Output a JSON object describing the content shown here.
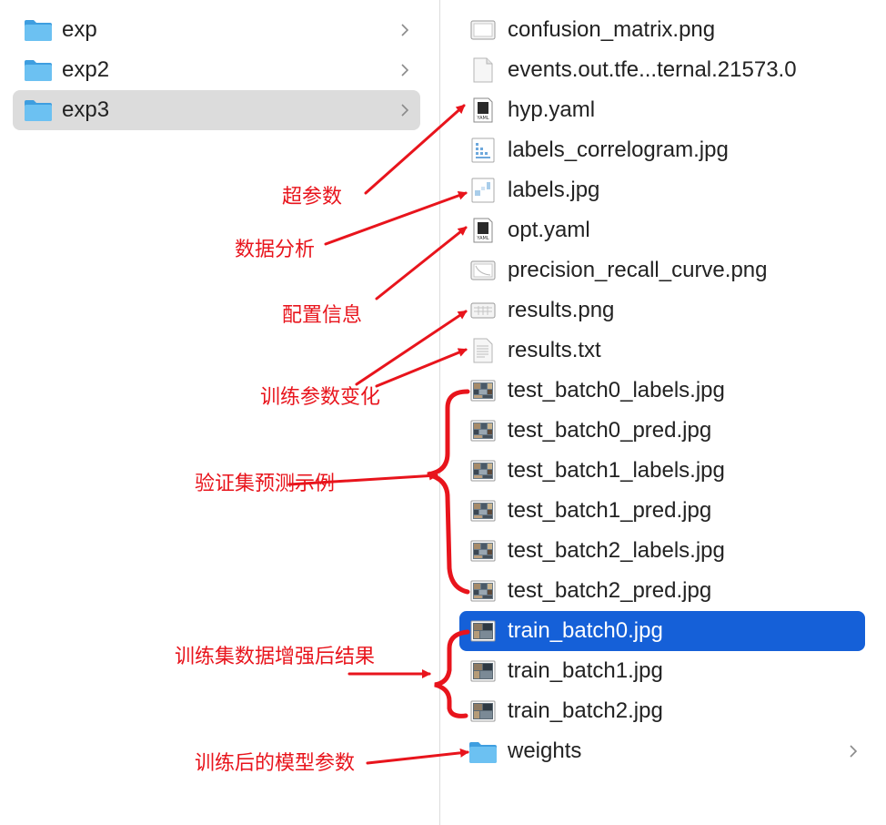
{
  "left_column": {
    "folders": [
      {
        "label": "exp",
        "icon": "folder-icon",
        "selected": false
      },
      {
        "label": "exp2",
        "icon": "folder-icon",
        "selected": false
      },
      {
        "label": "exp3",
        "icon": "folder-icon",
        "selected": true
      }
    ]
  },
  "right_column": {
    "files": [
      {
        "label": "confusion_matrix.png",
        "icon": "image-file-icon"
      },
      {
        "label": "events.out.tfe...ternal.21573.0",
        "icon": "blank-file-icon"
      },
      {
        "label": "hyp.yaml",
        "icon": "yaml-file-icon",
        "icon_text": "YAML"
      },
      {
        "label": "labels_correlogram.jpg",
        "icon": "image-file-icon"
      },
      {
        "label": "labels.jpg",
        "icon": "image-file-icon"
      },
      {
        "label": "opt.yaml",
        "icon": "yaml-file-icon",
        "icon_text": "YAML"
      },
      {
        "label": "precision_recall_curve.png",
        "icon": "image-file-icon"
      },
      {
        "label": "results.png",
        "icon": "image-file-icon"
      },
      {
        "label": "results.txt",
        "icon": "text-file-icon"
      },
      {
        "label": "test_batch0_labels.jpg",
        "icon": "photo-thumbnail-icon"
      },
      {
        "label": "test_batch0_pred.jpg",
        "icon": "photo-thumbnail-icon"
      },
      {
        "label": "test_batch1_labels.jpg",
        "icon": "photo-thumbnail-icon"
      },
      {
        "label": "test_batch1_pred.jpg",
        "icon": "photo-thumbnail-icon"
      },
      {
        "label": "test_batch2_labels.jpg",
        "icon": "photo-thumbnail-icon"
      },
      {
        "label": "test_batch2_pred.jpg",
        "icon": "photo-thumbnail-icon"
      },
      {
        "label": "train_batch0.jpg",
        "icon": "photo-thumbnail-icon",
        "selected": true
      },
      {
        "label": "train_batch1.jpg",
        "icon": "photo-thumbnail-icon"
      },
      {
        "label": "train_batch2.jpg",
        "icon": "photo-thumbnail-icon"
      },
      {
        "label": "weights",
        "icon": "folder-icon"
      }
    ]
  },
  "annotations": {
    "hyperparams": "超参数",
    "data_analysis": "数据分析",
    "config_info": "配置信息",
    "training_params_change": "训练参数变化",
    "val_set_pred_examples": "验证集预测示例",
    "train_set_augment_results": "训练集数据增强后结果",
    "trained_model_params": "训练后的模型参数"
  },
  "colors": {
    "selection_blue": "#1560d8",
    "selection_gray": "#dcdcdc",
    "folder_blue": "#5ab4ea",
    "annotation_red": "#e8141c"
  }
}
